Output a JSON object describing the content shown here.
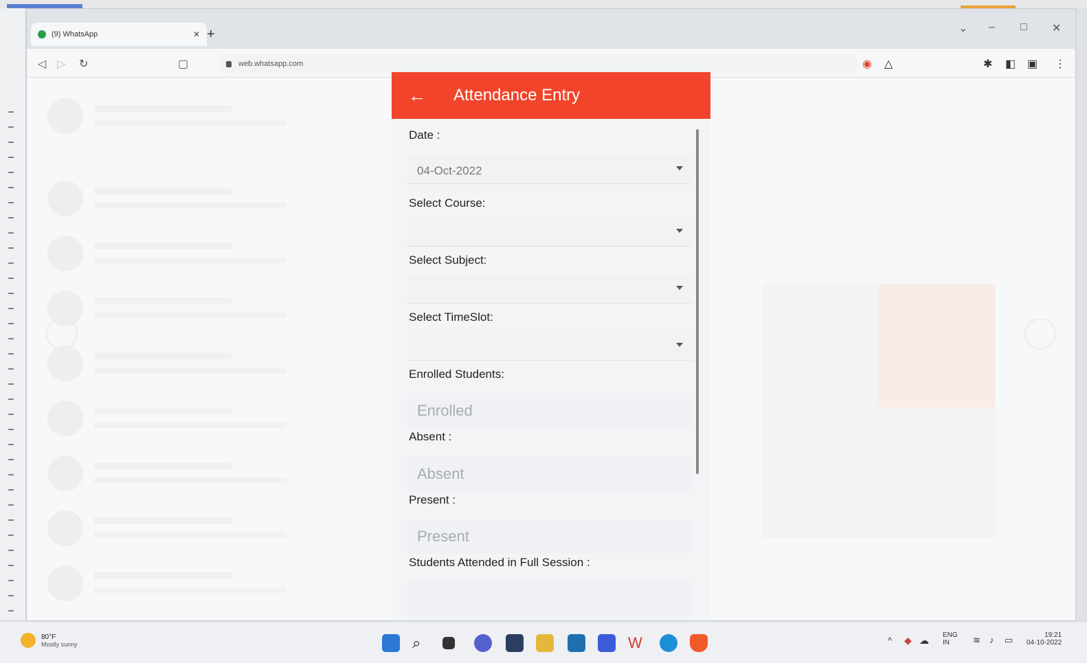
{
  "browser": {
    "tab_title": "(9) WhatsApp",
    "url": "web.whatsapp.com"
  },
  "app": {
    "title": "Attendance Entry",
    "fields": {
      "date_label": "Date :",
      "date_value": "04-Oct-2022",
      "course_label": "Select Course:",
      "subject_label": "Select Subject:",
      "timeslot_label": "Select TimeSlot:",
      "enrolled_label": "Enrolled Students:",
      "enrolled_placeholder": "Enrolled",
      "absent_label": "Absent :",
      "absent_placeholder": "Absent",
      "present_label": "Present :",
      "present_placeholder": "Present",
      "full_session_label": "Students Attended in Full Session :"
    },
    "colors": {
      "header": "#f2442a"
    }
  },
  "taskbar": {
    "weather_temp": "80°F",
    "weather_text": "Mostly sunny",
    "lang_top": "ENG",
    "lang_bottom": "IN",
    "time": "19:21",
    "date": "04-10-2022"
  }
}
